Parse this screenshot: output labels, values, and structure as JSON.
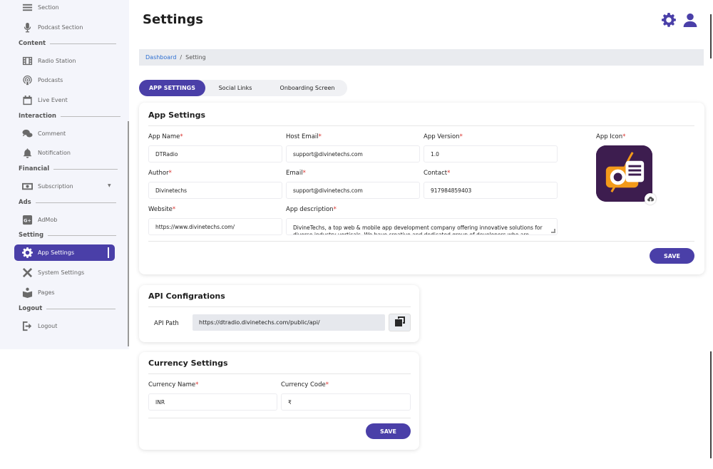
{
  "sidebar": {
    "items_top": [
      {
        "label": "Section",
        "icon": "menu-icon"
      },
      {
        "label": "Podcast Section",
        "icon": "microphone-icon"
      }
    ],
    "groups": {
      "content": "Content",
      "interaction": "Interaction",
      "financial": "Financial",
      "ads": "Ads",
      "setting": "Setting",
      "logout": "Logout"
    },
    "content_items": [
      {
        "label": "Radio Station",
        "icon": "film-icon"
      },
      {
        "label": "Podcasts",
        "icon": "podcast-icon"
      },
      {
        "label": "Live Event",
        "icon": "calendar-icon"
      }
    ],
    "interaction_items": [
      {
        "label": "Comment",
        "icon": "comment-icon"
      },
      {
        "label": "Notification",
        "icon": "bell-icon"
      }
    ],
    "financial_items": [
      {
        "label": "Subscription",
        "icon": "money-icon"
      }
    ],
    "ads_items": [
      {
        "label": "AdMob",
        "icon": "google-ads-icon"
      }
    ],
    "setting_items": [
      {
        "label": "App Settings",
        "icon": "gear-icon",
        "active": true
      },
      {
        "label": "System Settings",
        "icon": "tools-icon"
      },
      {
        "label": "Pages",
        "icon": "book-icon"
      }
    ],
    "logout_items": [
      {
        "label": "Logout",
        "icon": "logout-icon"
      }
    ]
  },
  "header": {
    "title": "Settings",
    "accent": "#4a3fa8"
  },
  "breadcrumb": {
    "home": "Dashboard",
    "separator": "/",
    "current": "Setting"
  },
  "tabs": [
    {
      "label": "APP SETTINGS",
      "active": true
    },
    {
      "label": "Social Links"
    },
    {
      "label": "Onboarding Screen"
    }
  ],
  "app_settings": {
    "title": "App Settings",
    "app_name": {
      "label": "App Name",
      "value": "DTRadio"
    },
    "host_email": {
      "label": "Host Email",
      "value": "support@divinetechs.com"
    },
    "app_version": {
      "label": "App Version",
      "value": "1.0"
    },
    "app_icon": {
      "label": "App Icon"
    },
    "author": {
      "label": "Author",
      "value": "Divinetechs"
    },
    "email": {
      "label": "Email",
      "value": "support@divinetechs.com"
    },
    "contact": {
      "label": "Contact",
      "value": "917984859403"
    },
    "website": {
      "label": "Website",
      "value": "https://www.divinetechs.com/"
    },
    "app_description": {
      "label": "App description",
      "value": "DivineTechs, a top web & mobile app development company offering innovative solutions for diverse industry verticals. We have creative and dedicated group of developers who are mastered"
    },
    "required_mark": "*",
    "save_label": "SAVE"
  },
  "api": {
    "title": "API Configrations",
    "label": "API Path",
    "value": "https://dtradio.divinetechs.com/public/api/"
  },
  "currency": {
    "title": "Currency Settings",
    "name": {
      "label": "Currency Name",
      "value": "INR"
    },
    "code": {
      "label": "Currency Code",
      "value": "₹"
    },
    "save_label": "SAVE"
  }
}
